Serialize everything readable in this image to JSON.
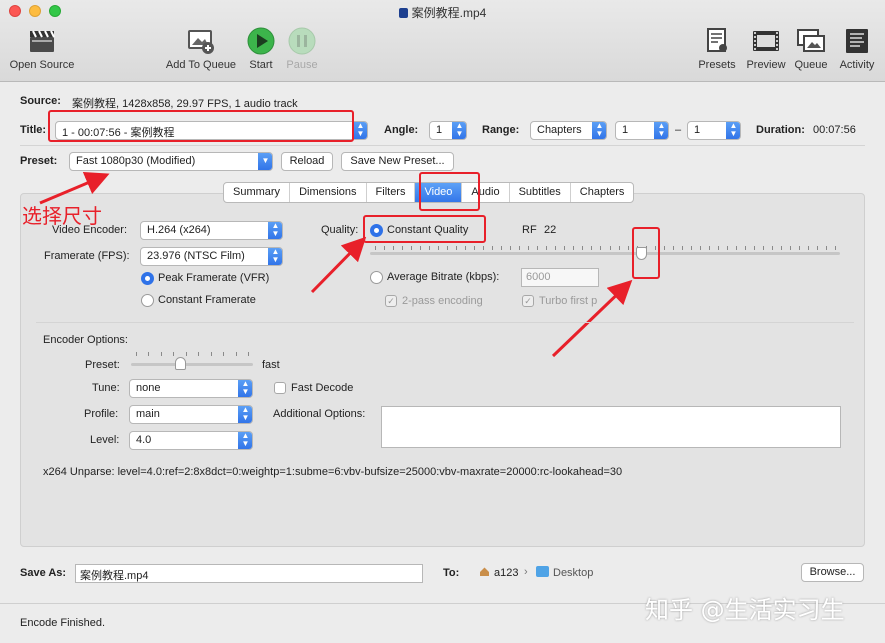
{
  "window": {
    "title": "案例教程.mp4",
    "colors": {
      "close": "#fc5753",
      "minimize": "#fdbc40",
      "zoom": "#33c748",
      "accent": "#2f72e8",
      "annotation": "#e8202a"
    }
  },
  "toolbar": {
    "open_source": "Open Source",
    "add_to_queue": "Add To Queue",
    "start": "Start",
    "pause": "Pause",
    "presets": "Presets",
    "preview": "Preview",
    "queue": "Queue",
    "activity": "Activity"
  },
  "source": {
    "label": "Source:",
    "value": "案例教程, 1428x858, 29.97 FPS, 1 audio track"
  },
  "title_row": {
    "title_label": "Title:",
    "title_value": "1 - 00:07:56 - 案例教程",
    "angle_label": "Angle:",
    "angle_value": "1",
    "range_label": "Range:",
    "range_type": "Chapters",
    "range_start": "1",
    "range_dash": "–",
    "range_end": "1",
    "duration_label": "Duration:",
    "duration_value": "00:07:56"
  },
  "preset_row": {
    "label": "Preset:",
    "value": "Fast 1080p30 (Modified)",
    "reload": "Reload",
    "save_new": "Save New Preset..."
  },
  "tabs": [
    "Summary",
    "Dimensions",
    "Filters",
    "Video",
    "Audio",
    "Subtitles",
    "Chapters"
  ],
  "active_tab": "Video",
  "annotation": {
    "text": "选择尺寸"
  },
  "video": {
    "encoder_label": "Video Encoder:",
    "encoder_value": "H.264 (x264)",
    "framerate_label": "Framerate (FPS):",
    "framerate_value": "23.976 (NTSC Film)",
    "peak_framerate": "Peak Framerate (VFR)",
    "constant_framerate": "Constant Framerate",
    "quality_label": "Quality:",
    "constant_quality": "Constant Quality",
    "rf_label": "RF",
    "rf_value": "22",
    "rf_slider_fraction": 0.58,
    "average_bitrate": "Average Bitrate (kbps):",
    "bitrate_placeholder": "6000",
    "two_pass": "2-pass encoding",
    "turbo_first": "Turbo first p"
  },
  "encoder_options": {
    "title": "Encoder Options:",
    "preset_label": "Preset:",
    "preset_value": "fast",
    "preset_slider_fraction": 0.4,
    "tune_label": "Tune:",
    "tune_value": "none",
    "fast_decode": "Fast Decode",
    "profile_label": "Profile:",
    "profile_value": "main",
    "additional_label": "Additional Options:",
    "level_label": "Level:",
    "level_value": "4.0",
    "unparse": "x264 Unparse: level=4.0:ref=2:8x8dct=0:weightp=1:subme=6:vbv-bufsize=25000:vbv-maxrate=20000:rc-lookahead=30"
  },
  "save": {
    "label": "Save As:",
    "value": "案例教程.mp4",
    "to_label": "To:",
    "path_user": "a123",
    "path_sep": "›",
    "path_folder": "Desktop",
    "browse": "Browse..."
  },
  "status": {
    "text": "Encode Finished."
  },
  "watermark": {
    "text": "知乎 @生活实习生"
  }
}
